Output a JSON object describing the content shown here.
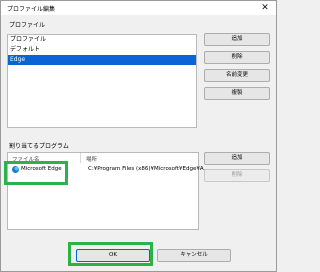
{
  "window": {
    "title": "プロファイル編集",
    "close_glyph": "✕"
  },
  "profiles": {
    "label": "プロファイル",
    "items": [
      "プロファイル",
      "デフォルト",
      "Edge"
    ],
    "selected": "Edge",
    "buttons": {
      "add": "追加",
      "delete": "削除",
      "rename": "名前変更",
      "duplicate": "複製"
    }
  },
  "programs": {
    "label": "割り当てるプログラム",
    "columns": {
      "file_name": "ファイル名",
      "path": "場所"
    },
    "rows": [
      {
        "icon": "microsoft-edge-icon",
        "file_name": "Microsoft Edge",
        "path": "C:¥Program Files (x86)¥Microsoft¥Edge¥A..."
      }
    ],
    "buttons": {
      "add": "追加",
      "delete": "削除"
    }
  },
  "footer": {
    "ok": "OK",
    "cancel": "キャンセル"
  },
  "colors": {
    "highlight": "#2bb34a",
    "selection": "#0a63d7"
  }
}
